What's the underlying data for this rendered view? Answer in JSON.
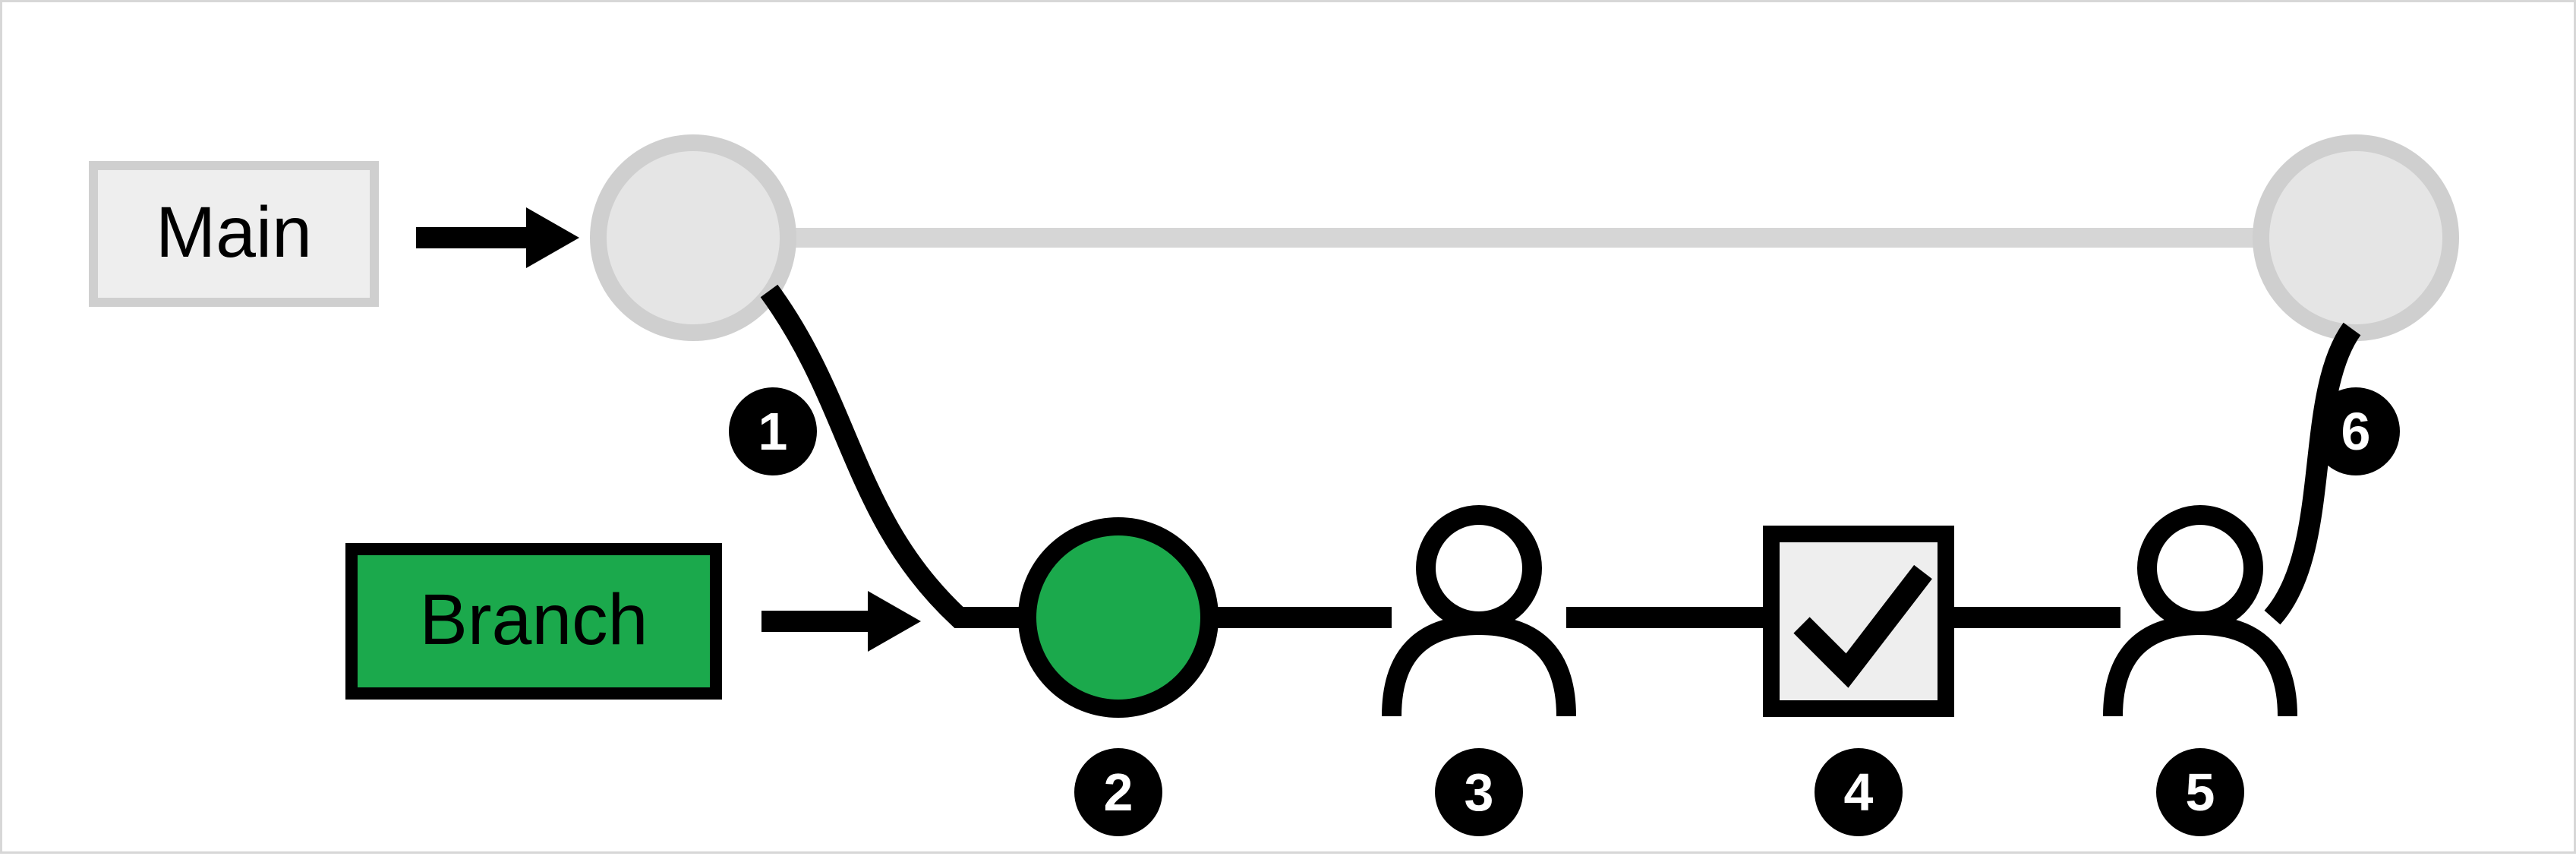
{
  "labels": {
    "main": "Main",
    "branch": "Branch"
  },
  "callouts": {
    "c1": "1",
    "c2": "2",
    "c3": "3",
    "c4": "4",
    "c5": "5",
    "c6": "6"
  },
  "colors": {
    "grey_node": "#e5e5e5",
    "grey_stroke": "#cfcfcf",
    "grey_line": "#d6d6d6",
    "green": "#1ba94c",
    "black": "#000000",
    "checkbox_fill": "#eeeeee"
  }
}
